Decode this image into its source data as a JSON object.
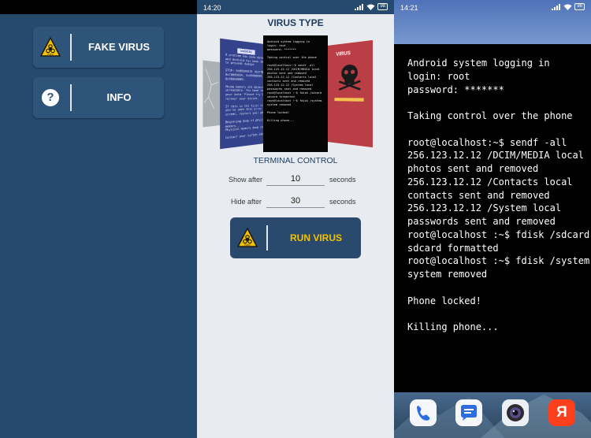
{
  "panel1": {
    "fake_virus_label": "FAKE VIRUS",
    "info_label": "INFO",
    "info_icon_glyph": "?",
    "hazard_sign_text": "TOXIC"
  },
  "panel2": {
    "status_time": "14:20",
    "battery": "98",
    "title": "VIRUS TYPE",
    "carousel": {
      "blue_card_header": "WARNING",
      "blue_card_text": "A problem has been detected\nand Android has been shut down\nto prevent damage.\n\nSTOP: 0x0000007B (0xF78D2524,\n0xC0000034, 0x00000000,\n0x00000000)\n\nPhone memory and object are\nunreadable. You have lost\nyour data. Please try to\nrecover your device.\n\nIf this is the first time\nyou've seen this error\nscreen, restart your phone.\n\nBeginning dump of physical\nmemory...\nPhysical memory dump complete.\n\nContact your system admin",
      "red_card_title": "VIRUS",
      "terminal_card_text": "Android system logging in\nlogin: root\npassword: *******\n\nTaking control over the phone\n\nroot@localhost:~$ sendf -all\n256.123.12.12 /DCIM/MEDIA local\nphotos sent and removed\n256.123.12.12 /Contacts local\ncontacts sent and removed\n256.123.12.12 /System local\npasswords sent and removed\nroot@localhost :~$ fdisk /sdcard\nsdcard formatted\nroot@localhost :~$ fdisk /system\nsystem removed\n\nPhone locked!\n\nKilling phone..."
    },
    "selected_type": "TERMINAL CONTROL",
    "show_after_label": "Show after",
    "show_after_value": "10",
    "hide_after_label": "Hide after",
    "hide_after_value": "30",
    "seconds_label": "seconds",
    "run_label": "RUN VIRUS"
  },
  "panel3": {
    "status_time": "14:21",
    "battery": "98",
    "terminal_text": "Android system logging in\nlogin: root\npassword: *******\n\nTaking control over the phone\n\nroot@localhost:~$ sendf -all\n256.123.12.12 /DCIM/MEDIA local\nphotos sent and removed\n256.123.12.12 /Contacts local\ncontacts sent and removed\n256.123.12.12 /System local\npasswords sent and removed\nroot@localhost :~$ fdisk /sdcard\nsdcard formatted\nroot@localhost :~$ fdisk /system\nsystem removed\n\nPhone locked!\n\nKilling phone...",
    "dock": [
      {
        "name": "phone-icon"
      },
      {
        "name": "messages-icon"
      },
      {
        "name": "camera-icon"
      },
      {
        "name": "yandex-icon",
        "glyph": "Я"
      }
    ]
  },
  "colors": {
    "app_bg": "#254a6e",
    "button_bg": "#2f5479",
    "title_color": "#1d3d61",
    "run_text": "#f2c200",
    "red_card": "#b93e46",
    "blue_card": "#33428a"
  }
}
